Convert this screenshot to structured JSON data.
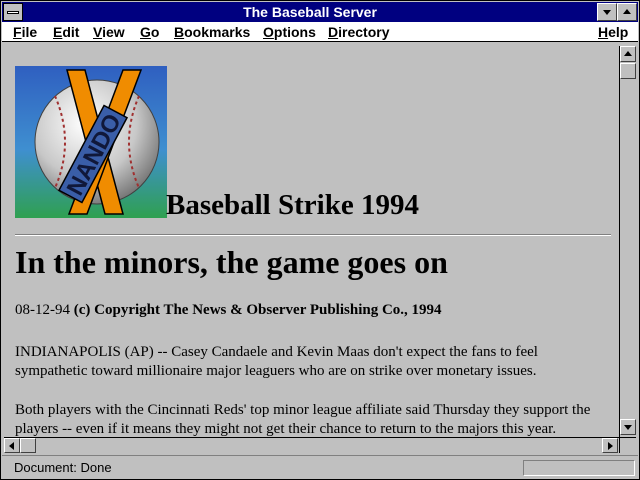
{
  "window": {
    "title": "The Baseball Server"
  },
  "menu": [
    {
      "hot": "F",
      "rest": "ile"
    },
    {
      "hot": "E",
      "rest": "dit"
    },
    {
      "hot": "V",
      "rest": "iew"
    },
    {
      "hot": "G",
      "rest": "o"
    },
    {
      "hot": "B",
      "rest": "ookmarks"
    },
    {
      "hot": "O",
      "rest": "ptions"
    },
    {
      "hot": "D",
      "rest": "irectory"
    },
    {
      "hot": "H",
      "rest": "elp"
    }
  ],
  "page": {
    "logo_text": "NANDO",
    "logo_letter": "X",
    "section_title": "Baseball Strike 1994",
    "headline": "In the minors, the game goes on",
    "date": "08-12-94",
    "copyright": "(c) Copyright The News & Observer Publishing Co., 1994",
    "paragraph1": "INDIANAPOLIS (AP) -- Casey Candaele and Kevin Maas don't expect the fans to feel sympathetic toward millionaire major leaguers who are on strike over monetary issues.",
    "paragraph2": "Both players with the Cincinnati Reds' top minor league affiliate said Thursday they support the players -- even if it means they might not get their chance to return to the majors this year."
  },
  "status": {
    "text": "Document: Done"
  },
  "colors": {
    "titlebar": "#000080",
    "chrome": "#c0c0c0",
    "logo_orange": "#f08c00",
    "logo_blue": "#3a5ea8"
  }
}
